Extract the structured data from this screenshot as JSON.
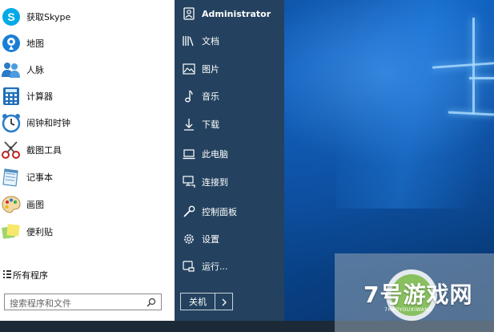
{
  "colors": {
    "left_pane_bg": "#ffffff",
    "right_pane_bg": "#24425f",
    "desktop_blue": "#0b5ab4",
    "taskbar": "#1c2a38"
  },
  "apps": [
    {
      "label": "获取Skype",
      "icon": "skype-icon"
    },
    {
      "label": "地图",
      "icon": "maps-icon"
    },
    {
      "label": "人脉",
      "icon": "people-icon"
    },
    {
      "label": "计算器",
      "icon": "calculator-icon"
    },
    {
      "label": "闹钟和时钟",
      "icon": "alarm-clock-icon"
    },
    {
      "label": "截图工具",
      "icon": "snipping-tool-icon"
    },
    {
      "label": "记事本",
      "icon": "notepad-icon"
    },
    {
      "label": "画图",
      "icon": "paint-icon"
    },
    {
      "label": "便利贴",
      "icon": "sticky-notes-icon"
    }
  ],
  "all_programs_label": "所有程序",
  "search": {
    "placeholder": "搜索程序和文件"
  },
  "places": [
    {
      "label": "Administrator",
      "icon": "user-icon"
    },
    {
      "label": "文档",
      "icon": "documents-icon"
    },
    {
      "label": "图片",
      "icon": "pictures-icon"
    },
    {
      "label": "音乐",
      "icon": "music-icon"
    },
    {
      "label": "下载",
      "icon": "download-icon"
    },
    {
      "label": "此电脑",
      "icon": "computer-icon"
    },
    {
      "label": "连接到",
      "icon": "connect-icon"
    },
    {
      "label": "控制面板",
      "icon": "control-panel-icon"
    },
    {
      "label": "设置",
      "icon": "settings-icon"
    },
    {
      "label": "运行...",
      "icon": "run-icon"
    }
  ],
  "power": {
    "label": "关机"
  },
  "watermark": {
    "main": "7号游戏网",
    "sub": "7HAOYOUXIWANG"
  }
}
